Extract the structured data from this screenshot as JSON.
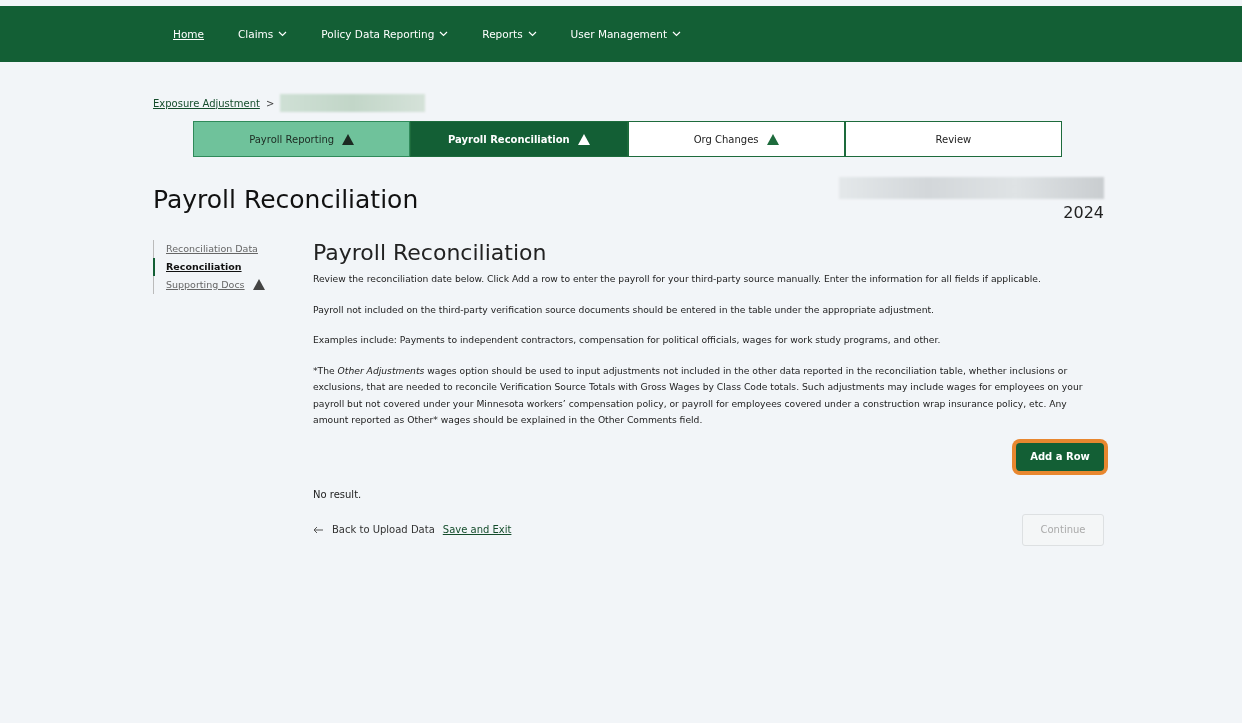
{
  "nav": [
    {
      "label": "Home",
      "dropdown": false,
      "selected": true
    },
    {
      "label": "Claims",
      "dropdown": true,
      "selected": false
    },
    {
      "label": "Policy Data Reporting",
      "dropdown": true,
      "selected": false
    },
    {
      "label": "Reports",
      "dropdown": true,
      "selected": false
    },
    {
      "label": "User Management",
      "dropdown": true,
      "selected": false
    }
  ],
  "breadcrumb": {
    "link": "Exposure Adjustment",
    "separator": ">"
  },
  "steps": [
    {
      "label": "Payroll Reporting",
      "completed": true,
      "selected": false,
      "warning": true
    },
    {
      "label": "Payroll Reconciliation",
      "completed": false,
      "selected": true,
      "warning": true
    },
    {
      "label": "Org Changes",
      "completed": false,
      "selected": false,
      "warning": true
    },
    {
      "label": "Review",
      "completed": false,
      "selected": false,
      "warning": false
    }
  ],
  "page_title": "Payroll Reconciliation",
  "year": "2024",
  "side_nav": [
    {
      "label": "Reconciliation Data",
      "selected": false,
      "warning": false
    },
    {
      "label": "Reconciliation",
      "selected": true,
      "warning": false
    },
    {
      "label": "Supporting Docs",
      "selected": false,
      "warning": true
    }
  ],
  "section_title": "Payroll Reconciliation",
  "paragraphs": [
    "Review the reconciliation date below. Click Add a row to enter the payroll for your third-party source manually. Enter the information for all fields if applicable.",
    "Payroll not included on the third-party verification source documents should be entered in the table under the appropriate adjustment.",
    "Examples include: Payments to independent contractors, compensation for political officials, wages for work study programs, and other.",
    "*The *Other Adjustments* wages option should be used to input adjustments not included in the other data reported in the reconciliation table, whether inclusions or exclusions, that are needed to reconcile Verification Source Totals with Gross Wages by Class Code totals. Such adjustments may include wages for employees on your payroll but not covered under your Minnesota workers’ compensation policy, or payroll for employees covered under a construction wrap insurance policy, etc. Any amount reported as Other* wages should be explained in the Other Comments field."
  ],
  "add_button": {
    "label": "Add a Row",
    "highlighted": true
  },
  "empty_message": "No result.",
  "back_link": "Back to Upload Data",
  "save_link": "Save and Exit",
  "continue_button": {
    "label": "Continue",
    "disabled": true
  }
}
